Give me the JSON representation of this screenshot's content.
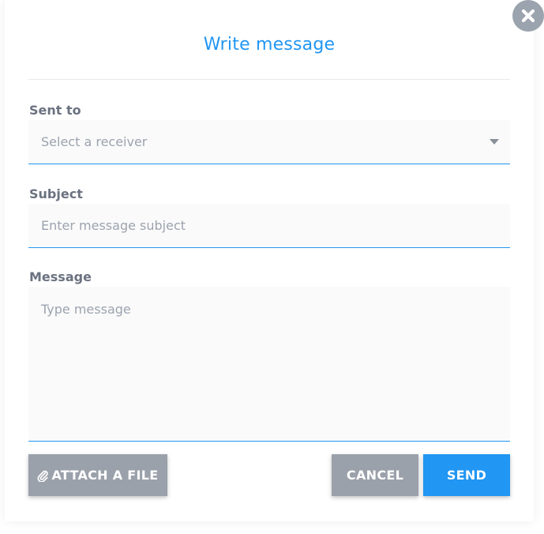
{
  "dialog": {
    "title": "Write message",
    "close_icon": "close-icon"
  },
  "form": {
    "recipient": {
      "label": "Sent to",
      "placeholder": "Select a receiver",
      "icon": "caret-down-icon"
    },
    "subject": {
      "label": "Subject",
      "placeholder": "Enter message subject"
    },
    "message": {
      "label": "Message",
      "placeholder": "Type message"
    }
  },
  "actions": {
    "attach_label": "ATTACH A FILE",
    "attach_icon": "paperclip-icon",
    "cancel_label": "CANCEL",
    "send_label": "SEND"
  },
  "colors": {
    "accent": "#2196f3",
    "secondary_button": "#9ba1ab",
    "label_text": "#6b7280",
    "placeholder_text": "#9ca3af"
  }
}
